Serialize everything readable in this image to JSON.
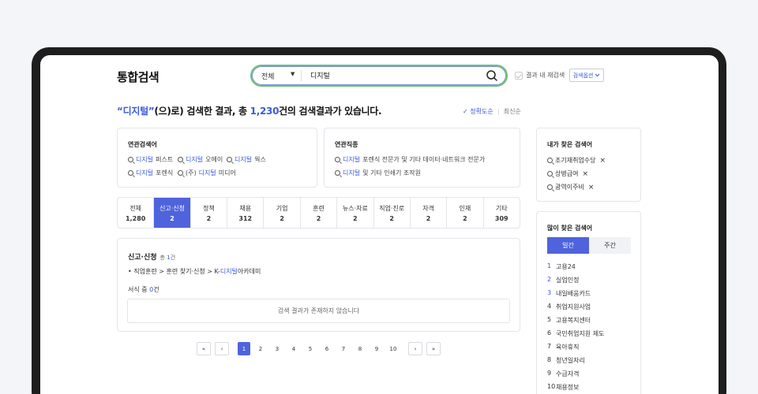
{
  "header": {
    "title": "통합검색",
    "scope": "전체",
    "query": "디지털",
    "within_label": "결과 내 재검색",
    "options_label": "검색옵션"
  },
  "summary": {
    "open_quote": "“",
    "keyword": "디지털",
    "close_quote": "”",
    "mid": "(으)로) 검색한 결과, 총 ",
    "count": "1,230",
    "tail": "건의 검색결과가 있습니다.",
    "sort_active": "정확도순",
    "sort_other": "최신순"
  },
  "related_search": {
    "title": "연관검색어",
    "items": [
      {
        "hl": "디지털",
        "rest": "퍼스트"
      },
      {
        "hl": "디지털",
        "rest": "오에이"
      },
      {
        "hl": "디지털",
        "rest": "웍스"
      },
      {
        "hl": "디지털",
        "rest": "포렌식"
      },
      {
        "pre": "(주)",
        "hl": "디지털",
        "rest": "미디어"
      }
    ]
  },
  "related_jobs": {
    "title": "연관직종",
    "items": [
      {
        "hl": "디지털",
        "rest": "포렌식 전문가 및 기타 데이터·네트워크 전문가"
      },
      {
        "hl": "디지털",
        "rest": " 및 기타 인쇄기 조작원"
      }
    ]
  },
  "tabs": [
    {
      "label": "전체",
      "count": "1,280"
    },
    {
      "label": "신고·신청",
      "count": "2"
    },
    {
      "label": "정책",
      "count": "2"
    },
    {
      "label": "채용",
      "count": "312"
    },
    {
      "label": "기업",
      "count": "2"
    },
    {
      "label": "훈련",
      "count": "2"
    },
    {
      "label": "뉴스·자료",
      "count": "2"
    },
    {
      "label": "직업·진로",
      "count": "2"
    },
    {
      "label": "자격",
      "count": "2"
    },
    {
      "label": "인재",
      "count": "2"
    },
    {
      "label": "기타",
      "count": "309"
    }
  ],
  "result": {
    "title": "신고·신청",
    "total_pre": "총 ",
    "total_num": "1",
    "total_suf": "건",
    "path_pre": "직업훈련 > 훈련 찾기·신청 > K-",
    "path_hl": "디지털",
    "path_suf": "아카데미",
    "forms_pre": "서식 중 ",
    "forms_num": "0",
    "forms_suf": "건",
    "empty_msg": "검색 결과가 존재하지 않습니다"
  },
  "pagination": {
    "first": "«",
    "prev": "‹",
    "next": "›",
    "last": "»",
    "pages": [
      "1",
      "2",
      "3",
      "4",
      "5",
      "6",
      "7",
      "8",
      "9",
      "10"
    ],
    "current": "1"
  },
  "my_searches": {
    "title": "내가 찾은 검색어",
    "items": [
      "조기재취업수당",
      "상병급여",
      "광역이주비"
    ],
    "remove": "×"
  },
  "popular": {
    "title": "많이 찾은 검색어",
    "tabs": [
      "일간",
      "주간"
    ],
    "items": [
      "고용24",
      "실업인정",
      "내일배움카드",
      "취업지원사업",
      "고용복지센터",
      "국민취업지원 제도",
      "육아휴직",
      "청년일자리",
      "수급자격",
      "채용정보"
    ]
  }
}
